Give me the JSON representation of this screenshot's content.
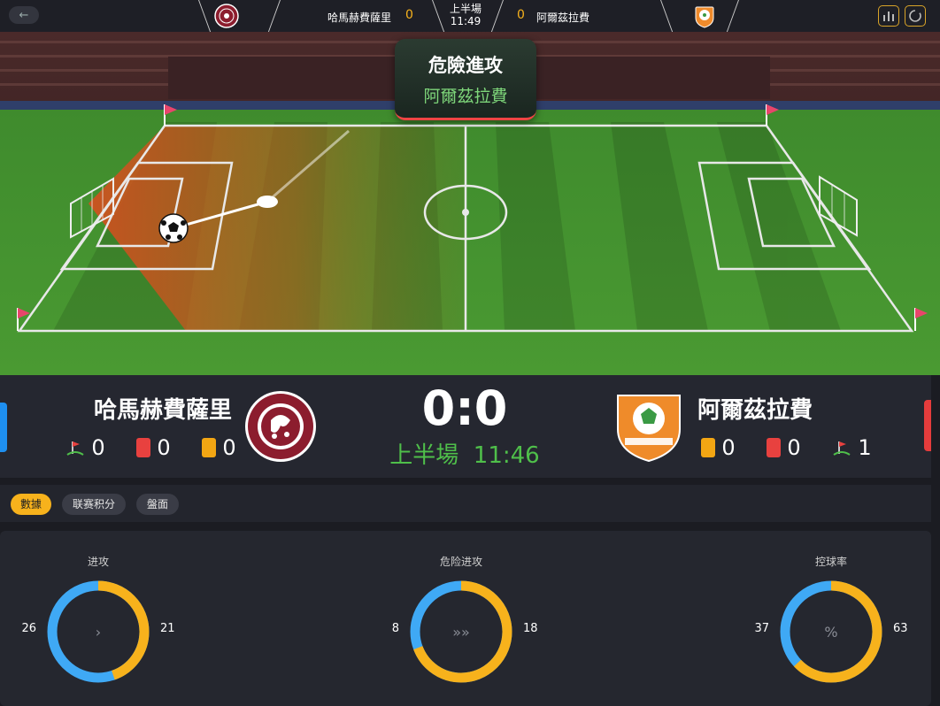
{
  "topbar": {
    "back_icon": "arrow-left-icon",
    "home_team": "哈馬赫費薩里",
    "home_score": "0",
    "period": "上半場",
    "clock": "11:49",
    "away_score": "0",
    "away_team": "阿爾茲拉費",
    "stats_icon": "bar-chart-icon",
    "refresh_icon": "refresh-icon"
  },
  "field": {
    "banner_title": "危險進攻",
    "banner_team": "阿爾茲拉費"
  },
  "scoreboard": {
    "home_name": "哈馬赫費薩里",
    "away_name": "阿爾茲拉費",
    "score": "0:0",
    "period_label": "上半場",
    "clock": "11:46",
    "home_corners": "0",
    "home_red": "0",
    "home_yellow": "0",
    "away_yellow": "0",
    "away_red": "0",
    "away_corners": "1",
    "home_color": "#1e8ff0",
    "away_color": "#e53c3c"
  },
  "tabs": [
    {
      "label": "數據",
      "active": true
    },
    {
      "label": "联赛积分",
      "active": false
    },
    {
      "label": "盤面",
      "active": false
    }
  ],
  "stats": [
    {
      "title": "进攻",
      "home": 26,
      "away": 21,
      "icon": "chevron-right-icon",
      "glyph": "›"
    },
    {
      "title": "危险进攻",
      "home": 8,
      "away": 18,
      "icon": "triple-chevron-icon",
      "glyph": "»»"
    },
    {
      "title": "控球率",
      "home": 37,
      "away": 63,
      "icon": "percent-icon",
      "glyph": "%"
    }
  ],
  "colors": {
    "home": "#3fa9f5",
    "away": "#f7b21c",
    "accent": "#f7b21c"
  }
}
